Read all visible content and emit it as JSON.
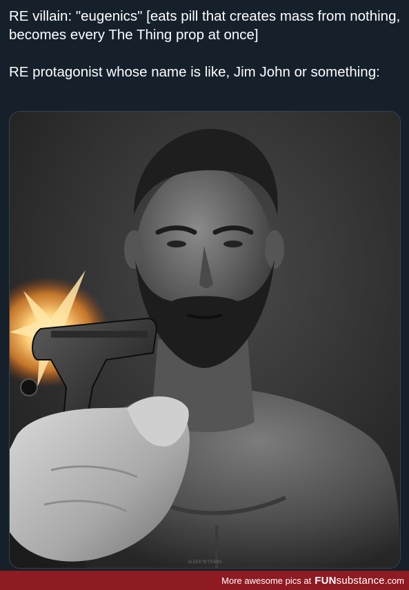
{
  "tweet": {
    "paragraph_1": "RE villain: \"eugenics\" [eats pill that creates mass from nothing, becomes every The Thing prop at once]",
    "paragraph_2": "RE protagonist whose name is like, Jim John or something:"
  },
  "media": {
    "watermark": "SLEEK'N'TEARS"
  },
  "footer": {
    "prefix": "More awesome pics at",
    "brand_fun": "FUN",
    "brand_substance": "substance",
    "brand_dotcom": ".com"
  },
  "colors": {
    "page_background": "#15202b",
    "text": "#ffffff",
    "footer_background": "#8e1a22",
    "card_border": "#38444d"
  }
}
